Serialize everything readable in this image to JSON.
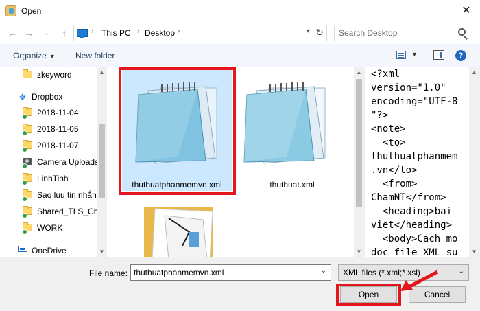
{
  "window": {
    "title": "Open",
    "close_glyph": "✕"
  },
  "nav": {
    "back": "←",
    "forward": "→",
    "up": "↑",
    "breadcrumb": [
      "This PC",
      "Desktop"
    ],
    "search_placeholder": "Search Desktop"
  },
  "toolbar": {
    "organize": "Organize",
    "new_folder": "New folder",
    "help": "?"
  },
  "sidebar": {
    "items": [
      {
        "label": "zkeyword",
        "icon": "folder-icon"
      },
      {
        "label": "Dropbox",
        "icon": "dropbox-icon"
      },
      {
        "label": "2018-11-04",
        "icon": "folder-sync-icon"
      },
      {
        "label": "2018-11-05",
        "icon": "folder-sync-icon"
      },
      {
        "label": "2018-11-07",
        "icon": "folder-sync-icon"
      },
      {
        "label": "Camera Uploads",
        "icon": "camera-folder-icon"
      },
      {
        "label": "LinhTinh",
        "icon": "folder-sync-icon"
      },
      {
        "label": "Sao luu tin nhắn",
        "icon": "folder-sync-icon"
      },
      {
        "label": "Shared_TLS_Cha",
        "icon": "shared-folder-icon"
      },
      {
        "label": "WORK",
        "icon": "folder-sync-icon"
      },
      {
        "label": "OneDrive",
        "icon": "onedrive-icon"
      }
    ]
  },
  "files": [
    {
      "name": "thuthuatphanmemvn.xml",
      "selected": true
    },
    {
      "name": "thuthuat.xml",
      "selected": false
    },
    {
      "name": "",
      "type": "folder"
    }
  ],
  "preview": {
    "lines": [
      "<?xml",
      "version=\"1.0\"",
      "encoding=\"UTF-8",
      "\"?>",
      "<note>",
      "  <to>",
      "thuthuatphanmem",
      ".vn</to>",
      "  <from>",
      "ChamNT</from>",
      "  <heading>bai",
      "viet</heading>",
      "  <body>Cach mo",
      "doc file XML su"
    ]
  },
  "footer": {
    "file_name_label": "File name:",
    "file_name_value": "thuthuatphanmemvn.xml",
    "filter_value": "XML files (*.xml;*.xsl)",
    "open_label": "Open",
    "cancel_label": "Cancel"
  },
  "colors": {
    "highlight": "#e4151d",
    "toolbar_bg": "#f3f6fb",
    "footer_bg": "#f0f0f0"
  }
}
